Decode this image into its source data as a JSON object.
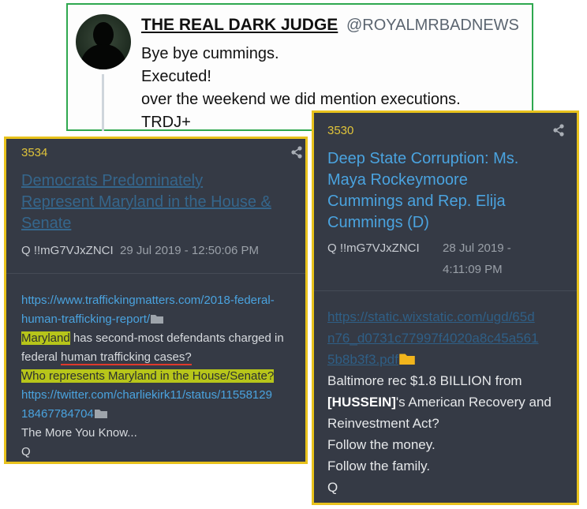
{
  "tweet": {
    "name": "THE REAL DARK JUDGE",
    "handle": "@ROYALMRBADNEWS",
    "lines": [
      "Bye bye cummings.",
      "Executed!",
      "over the weekend we did mention executions.",
      "TRDJ+"
    ]
  },
  "post_left": {
    "number": "3534",
    "title_lines": [
      "Democrats Predominately",
      "Represent Maryland in the House &",
      "Senate"
    ],
    "author": "Q !!mG7VJxZNCI",
    "date": "29 Jul 2019 - 12:50:06 PM",
    "link1_a": "https://www.traffickingmatters.com/2018-federal-",
    "link1_b": "human-trafficking-report/",
    "text1_hl": "Maryland",
    "text1_rest": " has second-most defendants charged in",
    "text2_a": "federal ",
    "text2_ul": "human trafficking cases?",
    "text3": "Who represents Maryland in the House/Senate?",
    "link2_a": "https://twitter.com/charliekirk11/status/11558129",
    "link2_b": "18467784704",
    "text4": "The More You Know...",
    "sign": "Q"
  },
  "post_right": {
    "number": "3530",
    "title_lines": [
      "Deep State Corruption: Ms.",
      "Maya Rockeymoore",
      "Cummings and Rep. Elija",
      "Cummings (D)"
    ],
    "author": "Q !!mG7VJxZNCI",
    "date_a": "28 Jul 2019 -",
    "date_b": "4:11:09 PM",
    "link_lines": [
      "https://static.wixstatic.com/ugd/65d",
      "n76_d0731c77997f4020a8c45a561",
      "5b8b3f3.pdf"
    ],
    "text1": "Baltimore rec $1.8 BILLION from",
    "text2_bold": "[HUSSEIN]",
    "text2_rest": "'s American Recovery and",
    "text3": "Reinvestment Act?",
    "text4": "Follow the money.",
    "text5": "Follow the family.",
    "sign": "Q"
  },
  "colors": {
    "tweet_border": "#2fa84f",
    "post_border": "#e8c21c",
    "post_bg": "#353a45",
    "link": "#4aa3df",
    "highlight": "#b7c51a"
  },
  "icons": [
    "share-icon",
    "folder-icon",
    "avatar"
  ]
}
